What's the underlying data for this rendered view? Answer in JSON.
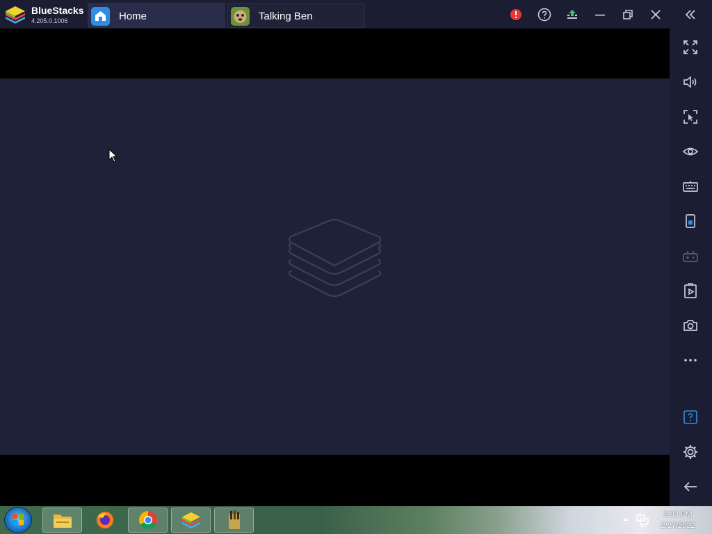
{
  "app": {
    "name": "BlueStacks",
    "version": "4.205.0.1006"
  },
  "tabs": [
    {
      "label": "Home",
      "icon": "home-icon"
    },
    {
      "label": "Talking Ben",
      "icon": "talking-ben-icon"
    }
  ],
  "titlebar": {
    "buttons": [
      "alert-icon",
      "help-icon",
      "update-icon",
      "minimize-icon",
      "restore-icon",
      "close-icon",
      "collapse-sidebar-icon"
    ],
    "alert_color": "#e53935",
    "update_color": "#46c06a"
  },
  "sidebar": {
    "buttons": [
      "fullscreen-icon",
      "volume-icon",
      "lock-cursor-icon",
      "eye-icon",
      "keyboard-icon",
      "rotate-icon",
      "gamepad-icon",
      "macro-icon",
      "screenshot-icon",
      "more-icon",
      "help-icon",
      "settings-icon",
      "back-icon"
    ]
  },
  "taskbar": {
    "apps": [
      "file-explorer-icon",
      "firefox-icon",
      "chrome-icon",
      "bluestacks-icon",
      "app-icon"
    ],
    "clock": {
      "time": "2:03 PM",
      "date": "2/27/2022"
    }
  },
  "colors": {
    "titlebar": "#1b1d33",
    "canvas": "#1f2138",
    "accent": "#2e8fe0"
  }
}
